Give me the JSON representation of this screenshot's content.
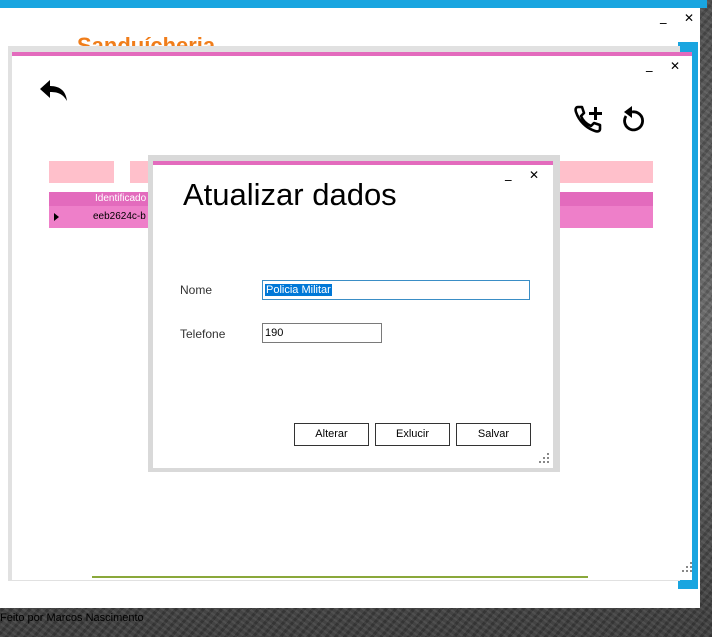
{
  "main_window": {
    "title": "Sanduícheria",
    "footer": "Feito por Marcos Nascimento",
    "minimize": "_",
    "close": "✕"
  },
  "second_window": {
    "minimize": "_",
    "close": "✕",
    "grid": {
      "column_header": "Identificado",
      "rows": [
        {
          "id": "eeb2624c-b"
        }
      ]
    }
  },
  "dialog": {
    "title": "Atualizar dados",
    "minimize": "_",
    "close": "✕",
    "fields": {
      "nome_label": "Nome",
      "nome_value": "Policia Militar",
      "telefone_label": "Telefone",
      "telefone_value": "190"
    },
    "buttons": {
      "alterar": "Alterar",
      "excluir": "Exlucir",
      "salvar": "Salvar"
    }
  },
  "icons": [
    "back-arrow-icon",
    "add-call-icon",
    "refresh-icon",
    "size-grip-icon"
  ],
  "colors": {
    "accent_pink": "#e36bbd",
    "row_pink": "#ee7fc9",
    "light_pink": "#ffc0cb",
    "title_orange": "#f07d1a",
    "accent_cyan": "#19a5e0",
    "selection_blue": "#0078d7"
  }
}
